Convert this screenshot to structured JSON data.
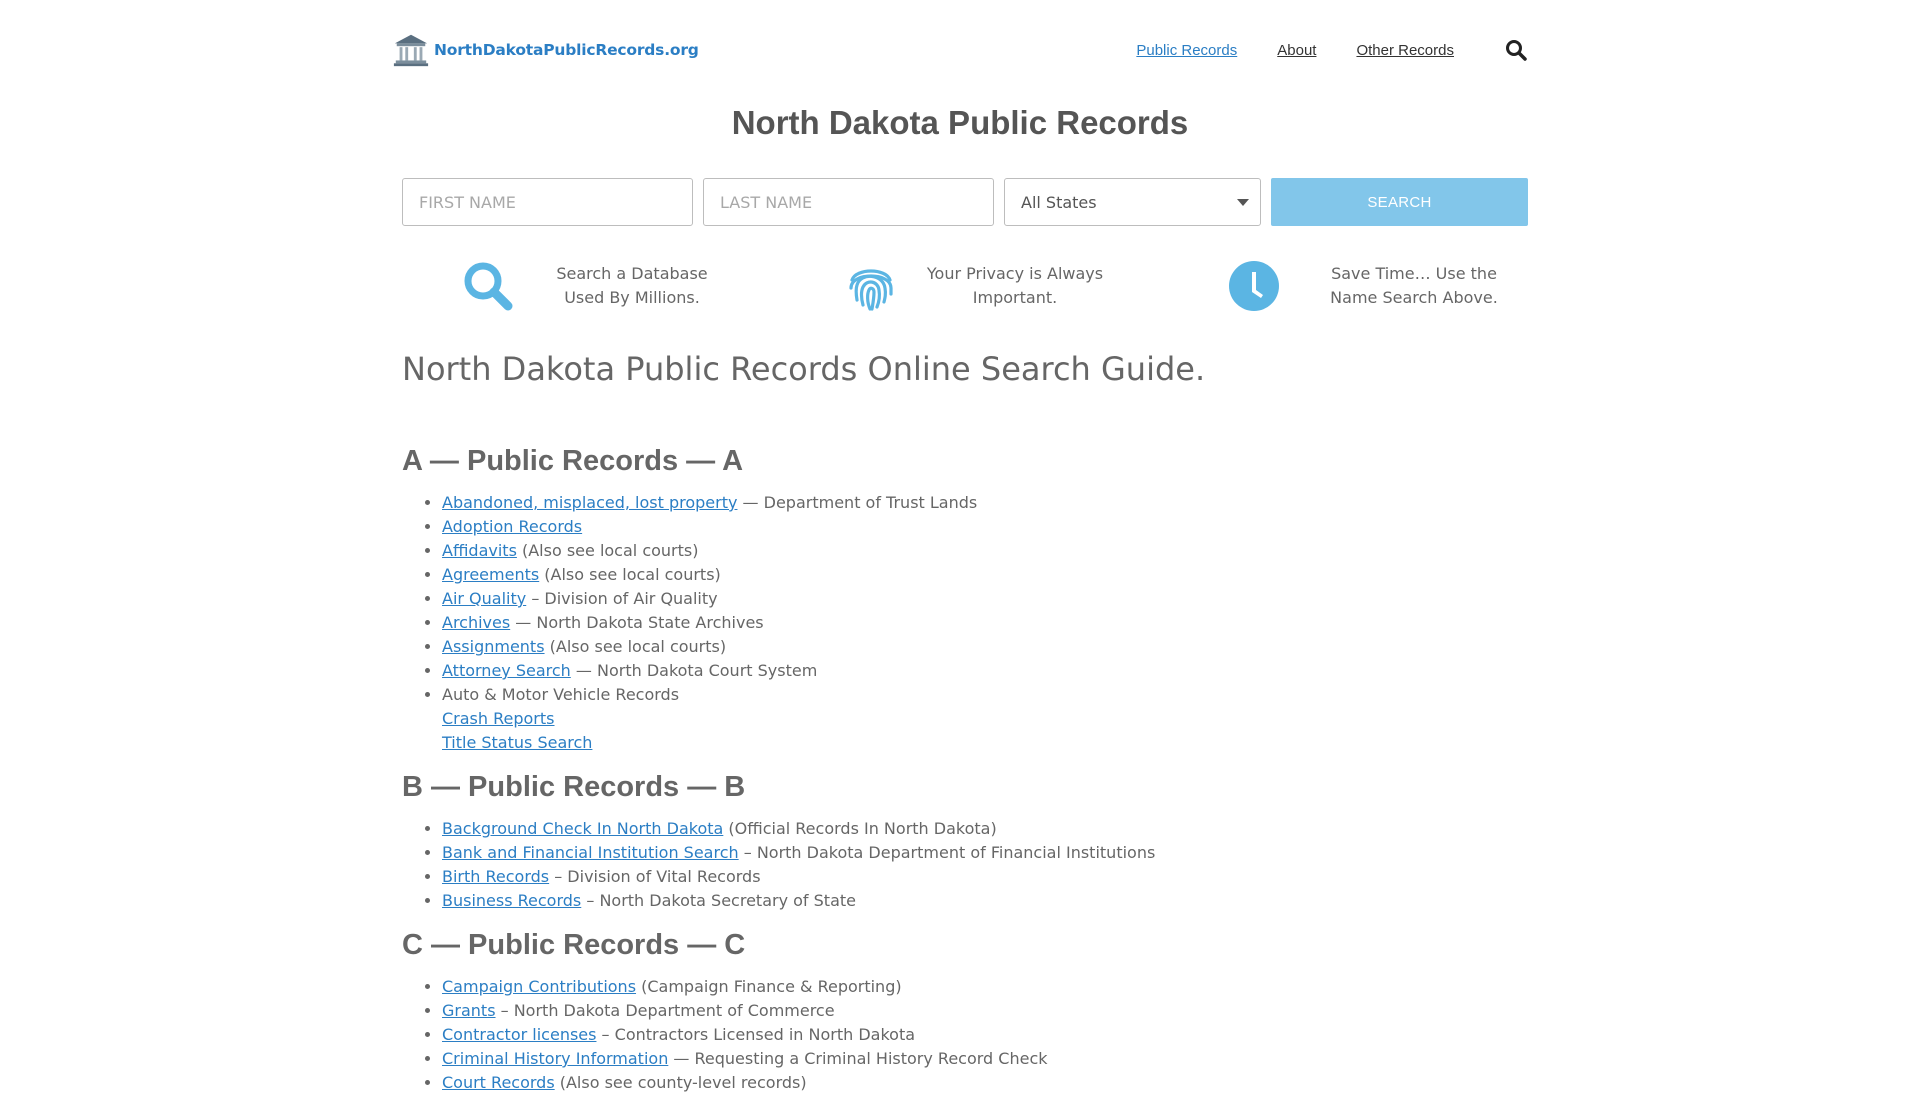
{
  "header": {
    "logo_text": "NorthDakotaPublicRecords.org",
    "nav": [
      {
        "label": "Public Records",
        "active": true
      },
      {
        "label": "About",
        "active": false
      },
      {
        "label": "Other Records",
        "active": false
      }
    ]
  },
  "page_title": "North Dakota Public Records",
  "search": {
    "first_placeholder": "FIRST NAME",
    "last_placeholder": "LAST NAME",
    "state_selected": "All States",
    "button_label": "SEARCH"
  },
  "features": [
    {
      "icon": "search-icon",
      "line1": "Search a Database",
      "line2": "Used By Millions."
    },
    {
      "icon": "fingerprint-icon",
      "line1": "Your Privacy is Always",
      "line2": "Important."
    },
    {
      "icon": "clock-icon",
      "line1": "Save Time… Use the",
      "line2": "Name Search Above."
    }
  ],
  "guide_title": "North Dakota Public Records Online Search Guide.",
  "sections": [
    {
      "title": "A — Public Records — A",
      "items": [
        {
          "link": "Abandoned, misplaced, lost property",
          "text": " — Department of Trust Lands"
        },
        {
          "link": "Adoption Records",
          "text": ""
        },
        {
          "link": "Affidavits",
          "text": " (Also see local courts)"
        },
        {
          "link": "Agreements",
          "text": " (Also see local courts)"
        },
        {
          "link": "Air Quality",
          "text": " – Division of Air Quality"
        },
        {
          "link": "Archives",
          "text": " — North Dakota State Archives"
        },
        {
          "link": "Assignments",
          "text": " (Also see local courts)"
        },
        {
          "link": "Attorney Search",
          "text": " — North Dakota Court System"
        },
        {
          "link": "",
          "text": "Auto & Motor Vehicle Records",
          "subs": [
            "Crash Reports",
            "Title Status Search"
          ]
        }
      ]
    },
    {
      "title": "B — Public Records — B",
      "items": [
        {
          "link": "Background Check In North Dakota",
          "text": " (Official Records In North Dakota)"
        },
        {
          "link": "Bank and Financial Institution Search",
          "text": " – North Dakota Department of Financial Institutions"
        },
        {
          "link": "Birth Records",
          "text": " – Division of Vital Records"
        },
        {
          "link": "Business Records",
          "text": " – North Dakota Secretary of State"
        }
      ]
    },
    {
      "title": "C — Public Records — C",
      "items": [
        {
          "link": "Campaign Contributions",
          "text": " (Campaign Finance & Reporting)"
        },
        {
          "link": "Grants",
          "text": " – North Dakota Department of Commerce"
        },
        {
          "link": "Contractor licenses",
          "text": " – Contractors Licensed in North Dakota"
        },
        {
          "link": "Criminal History Information",
          "text": " — Requesting a Criminal History Record Check"
        },
        {
          "link": "Court Records",
          "text": " (Also see county-level records)"
        }
      ]
    }
  ],
  "colors": {
    "link": "#2b7ec4",
    "accent": "#5bb5e3",
    "button": "#82c6ea"
  }
}
